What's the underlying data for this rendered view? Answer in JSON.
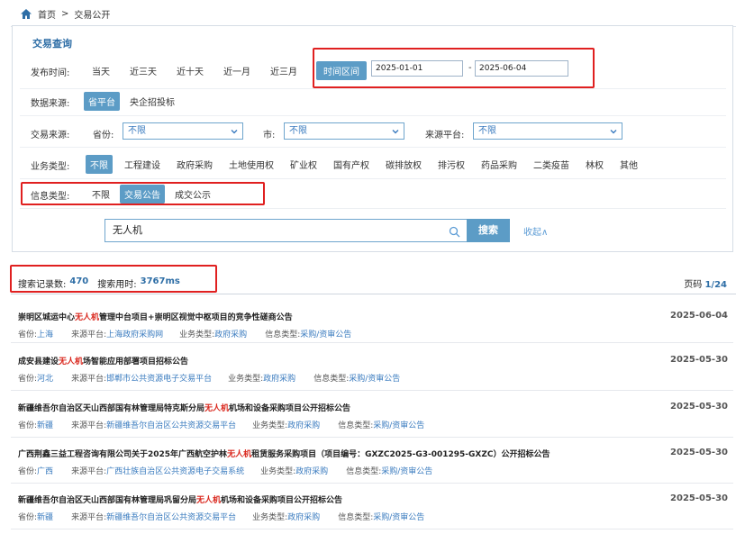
{
  "breadcrumb": {
    "home": "首页",
    "separator": ">",
    "current": "交易公开"
  },
  "panel": {
    "title": "交易查询"
  },
  "time_filter": {
    "label": "发布时间:",
    "options": [
      "当天",
      "近三天",
      "近十天",
      "近一月",
      "近三月"
    ],
    "range_button": "时间区间",
    "start_date": "2025-01-01",
    "end_date": "2025-06-04",
    "dash": "-"
  },
  "data_source": {
    "label": "数据来源:",
    "options": [
      "省平台",
      "央企招投标"
    ],
    "selected": "省平台"
  },
  "trade_source": {
    "label": "交易来源:",
    "province_label": "省份:",
    "province_value": "不限",
    "city_label": "市:",
    "city_value": "不限",
    "platform_label": "来源平台:",
    "platform_value": "不限"
  },
  "business_type": {
    "label": "业务类型:",
    "options": [
      "不限",
      "工程建设",
      "政府采购",
      "土地使用权",
      "矿业权",
      "国有产权",
      "碳排放权",
      "排污权",
      "药品采购",
      "二类疫苗",
      "林权",
      "其他"
    ],
    "selected": "不限"
  },
  "info_type": {
    "label": "信息类型:",
    "options": [
      "不限",
      "交易公告",
      "成交公示"
    ],
    "selected": "交易公告"
  },
  "search": {
    "value": "无人机",
    "button": "搜索",
    "collapse": "收起∧"
  },
  "stats": {
    "count_label": "搜索记录数:",
    "count": "470",
    "time_label": "搜索用时:",
    "time": "3767ms",
    "page_label": "页码",
    "page": "1/24"
  },
  "meta_labels": {
    "province": "省份:",
    "platform": "来源平台:",
    "business": "业务类型:",
    "info": "信息类型:"
  },
  "results": [
    {
      "title_pre": "崇明区城运中心",
      "title_hl": "无人机",
      "title_post": "管理中台项目+崇明区视觉中枢项目的竞争性磋商公告",
      "date": "2025-06-04",
      "province": "上海",
      "platform": "上海政府采购网",
      "business": "政府采购",
      "info": "采购/资审公告"
    },
    {
      "title_pre": "成安县建设",
      "title_hl": "无人机",
      "title_post": "场智能应用部署项目招标公告",
      "date": "2025-05-30",
      "province": "河北",
      "platform": "邯郸市公共资源电子交易平台",
      "business": "政府采购",
      "info": "采购/资审公告"
    },
    {
      "title_pre": "新疆维吾尔自治区天山西部国有林管理局特克斯分局",
      "title_hl": "无人机",
      "title_post": "机场和设备采购项目公开招标公告",
      "date": "2025-05-30",
      "province": "新疆",
      "platform": "新疆维吾尔自治区公共资源交易平台",
      "business": "政府采购",
      "info": "采购/资审公告"
    },
    {
      "title_pre": "广西荆鑫三益工程咨询有限公司关于2025年广西航空护林",
      "title_hl": "无人机",
      "title_post": "租赁服务采购项目（项目编号：GXZC2025-G3-001295-GXZC）公开招标公告",
      "date": "2025-05-30",
      "province": "广西",
      "platform": "广西壮族自治区公共资源电子交易系统",
      "business": "政府采购",
      "info": "采购/资审公告"
    },
    {
      "title_pre": "新疆维吾尔自治区天山西部国有林管理局巩留分局",
      "title_hl": "无人机",
      "title_post": "机场和设备采购项目公开招标公告",
      "date": "2025-05-30",
      "province": "新疆",
      "platform": "新疆维吾尔自治区公共资源交易平台",
      "business": "政府采购",
      "info": "采购/资审公告"
    }
  ],
  "colors": {
    "accent": "#5c9cc6",
    "title_blue": "#2e6ea6",
    "highlight_red": "#d9261c",
    "annotation_red": "#e02020"
  }
}
